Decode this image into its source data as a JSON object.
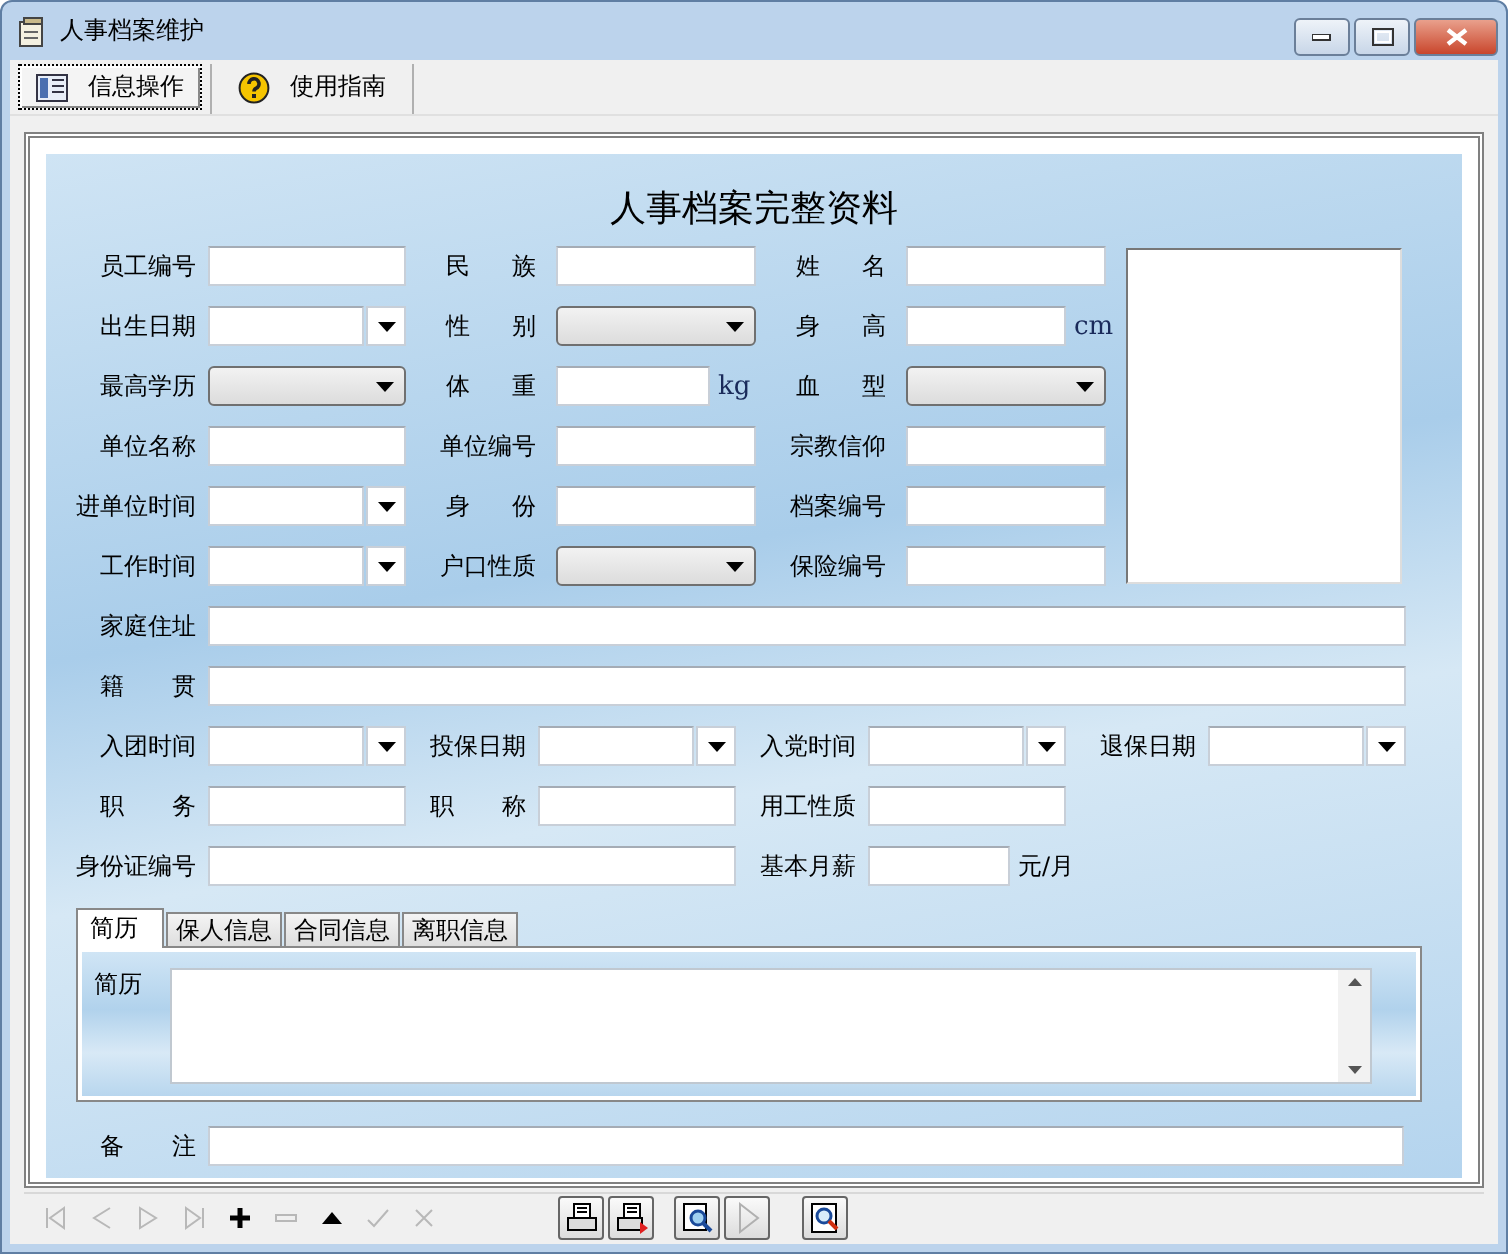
{
  "window": {
    "title": "人事档案维护"
  },
  "toolbar": [
    {
      "label": "信息操作",
      "kind": "list",
      "selected": true
    },
    {
      "label": "使用指南",
      "kind": "help",
      "selected": false
    }
  ],
  "form": {
    "title": "人事档案完整资料",
    "top_fields": [
      {
        "label": "员工编号",
        "kind": "text"
      },
      {
        "label": "民　族",
        "kind": "text",
        "spread": true
      },
      {
        "label": "姓　名",
        "kind": "text",
        "spread": true
      },
      {
        "label": "出生日期",
        "kind": "date"
      },
      {
        "label": "性　别",
        "kind": "select",
        "spread": true
      },
      {
        "label": "身　高",
        "kind": "short",
        "unit": "cm",
        "spread": true
      },
      {
        "label": "最高学历",
        "kind": "select"
      },
      {
        "label": "体　重",
        "kind": "short",
        "unit": "kg",
        "spread": true
      },
      {
        "label": "血　型",
        "kind": "select",
        "spread": true
      },
      {
        "label": "单位名称",
        "kind": "text"
      },
      {
        "label": "单位编号",
        "kind": "text"
      },
      {
        "label": "宗教信仰",
        "kind": "text"
      },
      {
        "label": "进单位时间",
        "kind": "date"
      },
      {
        "label": "身　份",
        "kind": "text",
        "spread": true
      },
      {
        "label": "档案编号",
        "kind": "text"
      },
      {
        "label": "工作时间",
        "kind": "date"
      },
      {
        "label": "户口性质",
        "kind": "select"
      },
      {
        "label": "保险编号",
        "kind": "text"
      }
    ],
    "lower_fields": [
      {
        "label": "家庭住址",
        "kind": "wide"
      },
      {
        "label": "籍　贯",
        "kind": "wide",
        "spread": true
      },
      {
        "label": "入团时间",
        "kind": "date"
      },
      {
        "label": "投保日期",
        "kind": "date"
      },
      {
        "label": "入党时间",
        "kind": "date"
      },
      {
        "label": "退保日期",
        "kind": "date"
      },
      {
        "label": "职　务",
        "kind": "text",
        "spread": true
      },
      {
        "label": "职　称",
        "kind": "text",
        "spread": true
      },
      {
        "label": "用工性质",
        "kind": "text"
      },
      {
        "kind": "blank"
      },
      {
        "label": "身份证编号",
        "kind": "long"
      },
      {
        "label": "基本月薪",
        "kind": "short",
        "unit": "元/月"
      }
    ],
    "tabs": [
      {
        "label": "简历",
        "selected": true
      },
      {
        "label": "保人信息",
        "selected": false
      },
      {
        "label": "合同信息",
        "selected": false
      },
      {
        "label": "离职信息",
        "selected": false
      }
    ],
    "tab_panel": {
      "label": "简历"
    },
    "remark": {
      "label": "备　注",
      "spread": true
    }
  },
  "navigator": [
    {
      "kind": "first",
      "disabled": true
    },
    {
      "kind": "prev",
      "disabled": true
    },
    {
      "kind": "next",
      "disabled": true
    },
    {
      "kind": "last",
      "disabled": true
    },
    {
      "kind": "add",
      "disabled": false
    },
    {
      "kind": "delete",
      "disabled": true
    },
    {
      "kind": "edit",
      "disabled": false
    },
    {
      "kind": "post",
      "disabled": true
    },
    {
      "kind": "cancel",
      "disabled": true
    }
  ],
  "reports": [
    {
      "kind": "print",
      "disabled": false
    },
    {
      "kind": "print-red",
      "disabled": false
    },
    {
      "kind": "preview",
      "disabled": false
    },
    {
      "kind": "play",
      "disabled": true
    },
    {
      "kind": "find",
      "disabled": false
    }
  ]
}
